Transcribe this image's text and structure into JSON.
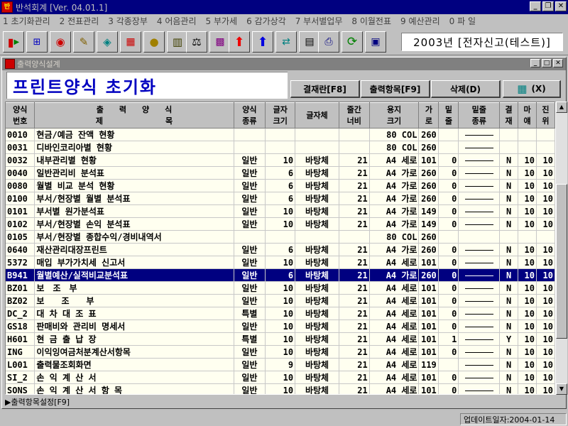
{
  "window": {
    "title": "반석회계 [Ver. 04.01.1]",
    "app_icon": "app-logo-icon"
  },
  "menu": [
    "1 초기화관리",
    "2 전표관리",
    "3 각종장부",
    "4 어음관리",
    "5 부가세",
    "6 감가상각",
    "7 부서별업무",
    "8 이월전표",
    "9 예산관리",
    "0 파 일"
  ],
  "company": "2003년 [전자신고(테스트)]",
  "child_window": {
    "title": "출력양식설계"
  },
  "page_title": "프린트양식 초기화",
  "buttons": {
    "approval": "결재란[F8]",
    "output_items": "출력항목[F9]",
    "delete": "삭제(D)",
    "exit": "(X)"
  },
  "headers": {
    "code": [
      "양식",
      "번호"
    ],
    "title": [
      "출　　력　　양　　식",
      "제　　　　　　　　목"
    ],
    "kind": [
      "양식",
      "종류"
    ],
    "fsize": [
      "글자",
      "크기"
    ],
    "font": [
      "글자체"
    ],
    "colw": [
      "줄간",
      "너비"
    ],
    "paper": [
      "용지",
      "크기"
    ],
    "width": [
      "가",
      "로"
    ],
    "ul": [
      "밑",
      "줄"
    ],
    "ultype": [
      "밑줄",
      "종류"
    ],
    "appr": [
      "결",
      "재"
    ],
    "margin": [
      "마",
      "얘"
    ],
    "indent": [
      "진",
      "위"
    ]
  },
  "rows": [
    {
      "code": "0010",
      "title": "현금/예금 잔액 현황",
      "kind": "",
      "fsize": "",
      "font": "",
      "colw": "",
      "paper": "80 COL",
      "width": "260",
      "ul": "",
      "ultype": true,
      "appr": "",
      "margin": "",
      "indent": ""
    },
    {
      "code": "0031",
      "title": "디바인코리아별 현황",
      "kind": "",
      "fsize": "",
      "font": "",
      "colw": "",
      "paper": "80 COL",
      "width": "260",
      "ul": "",
      "ultype": true,
      "appr": "",
      "margin": "",
      "indent": ""
    },
    {
      "code": "0032",
      "title": "내부관리별 현황",
      "kind": "일반",
      "fsize": "10",
      "font": "바탕체",
      "colw": "21",
      "paper": "A4 세로",
      "width": "101",
      "ul": "0",
      "ultype": true,
      "appr": "N",
      "margin": "10",
      "indent": "10"
    },
    {
      "code": "0040",
      "title": "일반관리비 분석표",
      "kind": "일반",
      "fsize": "6",
      "font": "바탕체",
      "colw": "21",
      "paper": "A4 가로",
      "width": "260",
      "ul": "0",
      "ultype": true,
      "appr": "N",
      "margin": "10",
      "indent": "10"
    },
    {
      "code": "0080",
      "title": "월별 비교 분석 현황",
      "kind": "일반",
      "fsize": "6",
      "font": "바탕체",
      "colw": "21",
      "paper": "A4 가로",
      "width": "260",
      "ul": "0",
      "ultype": true,
      "appr": "N",
      "margin": "10",
      "indent": "10"
    },
    {
      "code": "0100",
      "title": "부서/현장별 월별 분석표",
      "kind": "일반",
      "fsize": "6",
      "font": "바탕체",
      "colw": "21",
      "paper": "A4 가로",
      "width": "260",
      "ul": "0",
      "ultype": true,
      "appr": "N",
      "margin": "10",
      "indent": "10"
    },
    {
      "code": "0101",
      "title": "부서별 원가분석표",
      "kind": "일반",
      "fsize": "10",
      "font": "바탕체",
      "colw": "21",
      "paper": "A4 가로",
      "width": "149",
      "ul": "0",
      "ultype": true,
      "appr": "N",
      "margin": "10",
      "indent": "10"
    },
    {
      "code": "0102",
      "title": "부서/현장별 손익 분석표",
      "kind": "일반",
      "fsize": "10",
      "font": "바탕체",
      "colw": "21",
      "paper": "A4 가로",
      "width": "149",
      "ul": "0",
      "ultype": true,
      "appr": "N",
      "margin": "10",
      "indent": "10"
    },
    {
      "code": "0105",
      "title": "부서/현장별 종합수익/경비내역서",
      "kind": "",
      "fsize": "",
      "font": "",
      "colw": "",
      "paper": "80 COL",
      "width": "260",
      "ul": "",
      "ultype": false,
      "appr": "",
      "margin": "",
      "indent": ""
    },
    {
      "code": "0640",
      "title": "재산관리대장프린트",
      "kind": "일반",
      "fsize": "6",
      "font": "바탕체",
      "colw": "21",
      "paper": "A4 가로",
      "width": "260",
      "ul": "0",
      "ultype": true,
      "appr": "N",
      "margin": "10",
      "indent": "10"
    },
    {
      "code": "5372",
      "title": "매입 부가가치세 신고서",
      "kind": "일반",
      "fsize": "10",
      "font": "바탕체",
      "colw": "21",
      "paper": "A4 세로",
      "width": "101",
      "ul": "0",
      "ultype": true,
      "appr": "N",
      "margin": "10",
      "indent": "10"
    },
    {
      "code": "B941",
      "title": "월별예산/실적비교분석표",
      "kind": "일반",
      "fsize": "6",
      "font": "바탕체",
      "colw": "21",
      "paper": "A4 가로",
      "width": "260",
      "ul": "0",
      "ultype": true,
      "appr": "N",
      "margin": "10",
      "indent": "10",
      "selected": true
    },
    {
      "code": "BZ01",
      "title": "보　조　부",
      "kind": "일반",
      "fsize": "10",
      "font": "바탕체",
      "colw": "21",
      "paper": "A4 세로",
      "width": "101",
      "ul": "0",
      "ultype": true,
      "appr": "N",
      "margin": "10",
      "indent": "10"
    },
    {
      "code": "BZ02",
      "title": "보　　조　　부",
      "kind": "일반",
      "fsize": "10",
      "font": "바탕체",
      "colw": "21",
      "paper": "A4 세로",
      "width": "101",
      "ul": "0",
      "ultype": true,
      "appr": "N",
      "margin": "10",
      "indent": "10"
    },
    {
      "code": "DC_2",
      "title": "대 차 대 조 표",
      "kind": "특별",
      "fsize": "10",
      "font": "바탕체",
      "colw": "21",
      "paper": "A4 세로",
      "width": "101",
      "ul": "0",
      "ultype": true,
      "appr": "N",
      "margin": "10",
      "indent": "10"
    },
    {
      "code": "GS18",
      "title": "판매비와 관리비 명세서",
      "kind": "일반",
      "fsize": "10",
      "font": "바탕체",
      "colw": "21",
      "paper": "A4 세로",
      "width": "101",
      "ul": "0",
      "ultype": true,
      "appr": "N",
      "margin": "10",
      "indent": "10"
    },
    {
      "code": "H601",
      "title": "현 금 출 납 장",
      "kind": "특별",
      "fsize": "10",
      "font": "바탕체",
      "colw": "21",
      "paper": "A4 세로",
      "width": "101",
      "ul": "1",
      "ultype": true,
      "appr": "Y",
      "margin": "10",
      "indent": "10"
    },
    {
      "code": "ING",
      "title": "이익잉여금처분계산서항목",
      "kind": "일반",
      "fsize": "10",
      "font": "바탕체",
      "colw": "21",
      "paper": "A4 세로",
      "width": "101",
      "ul": "0",
      "ultype": true,
      "appr": "N",
      "margin": "10",
      "indent": "10"
    },
    {
      "code": "L001",
      "title": "출력물조회화면",
      "kind": "일반",
      "fsize": "9",
      "font": "바탕체",
      "colw": "21",
      "paper": "A4 세로",
      "width": "119",
      "ul": "",
      "ultype": true,
      "appr": "N",
      "margin": "10",
      "indent": "10"
    },
    {
      "code": "SI_2",
      "title": "손 익 계 산 서",
      "kind": "일반",
      "fsize": "10",
      "font": "바탕체",
      "colw": "21",
      "paper": "A4 세로",
      "width": "101",
      "ul": "0",
      "ultype": true,
      "appr": "N",
      "margin": "10",
      "indent": "10"
    },
    {
      "code": "SONS",
      "title": "손 익 계 산 서 항 목",
      "kind": "일반",
      "fsize": "10",
      "font": "바탕체",
      "colw": "21",
      "paper": "A4 세로",
      "width": "101",
      "ul": "0",
      "ultype": true,
      "appr": "N",
      "margin": "10",
      "indent": "10"
    },
    {
      "code": "SS01",
      "title": "합계잔액시산표",
      "kind": "일반",
      "fsize": "10",
      "font": "바탕체",
      "colw": "21",
      "paper": "A4 세로",
      "width": "101",
      "ul": "0",
      "ultype": true,
      "appr": "N",
      "margin": "10",
      "indent": "10"
    }
  ],
  "footer_tab": "▶출력항목설정[F9]",
  "status": {
    "update": "업데이트일자:2004-01-14"
  },
  "toolbar_icons": [
    "exit-door-icon",
    "org-tree-icon",
    "globe-icon",
    "pencil-edit-icon",
    "tag-icon",
    "abacus-icon",
    "coin-icon",
    "books-icon",
    "scale-icon",
    "grid-icon",
    "arrow-up-red-icon",
    "arrow-up-blue-icon",
    "translate-icon",
    "calculator-icon",
    "printer-icon",
    "refresh-icon",
    "report-icon"
  ],
  "colors": {
    "accent": "#000080",
    "title_text": "#0000c0",
    "row_bg": "#fffff0"
  }
}
